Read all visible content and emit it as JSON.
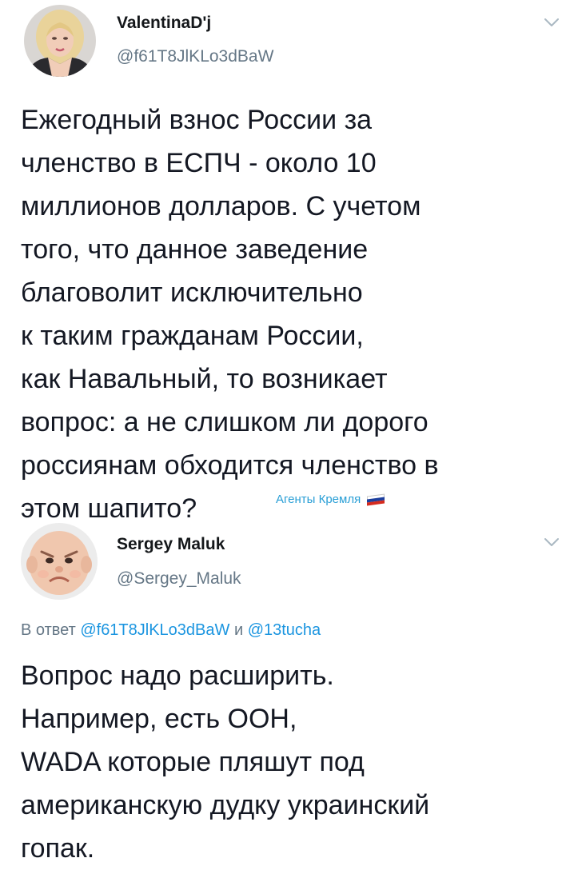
{
  "tweets": [
    {
      "author": {
        "display_name": "ValentinaD'j",
        "handle": "@f61T8JlKLo3dBaW",
        "avatar_icon": "profile-photo-woman"
      },
      "menu_icon": "chevron-down-icon",
      "body_lines": [
        "Ежегодный взнос России за",
        "членство в ЕСПЧ - около 10",
        "миллионов долларов. С учетом",
        "того, что данное заведение",
        "благоволит исключительно",
        "к таким гражданам России,",
        "как Навальный, то возникает",
        "вопрос: а не слишком ли дорого",
        "россиянам обходится членство в",
        "этом шапито?"
      ],
      "watermark": "Агенты Кремля"
    },
    {
      "author": {
        "display_name": "Sergey Maluk",
        "handle": "@Sergey_Maluk",
        "avatar_icon": "profile-photo-baby"
      },
      "menu_icon": "chevron-down-icon",
      "reply_to": {
        "prefix": "В ответ",
        "mention_1": "@f61T8JlKLo3dBaW",
        "conjunction": "и",
        "mention_2": "@13tucha"
      },
      "body_lines": [
        "Вопрос надо расширить.",
        "Например, есть ООН,",
        "WADA которые пляшут под",
        "американскую дудку украинский",
        "гопак."
      ]
    }
  ],
  "colors": {
    "text": "#141823",
    "secondary": "#657786",
    "link": "#1b95e0",
    "watermark": "#2a9fd6",
    "flag_white": "#ffffff",
    "flag_blue": "#1c3f9e",
    "flag_red": "#d52b1e"
  }
}
